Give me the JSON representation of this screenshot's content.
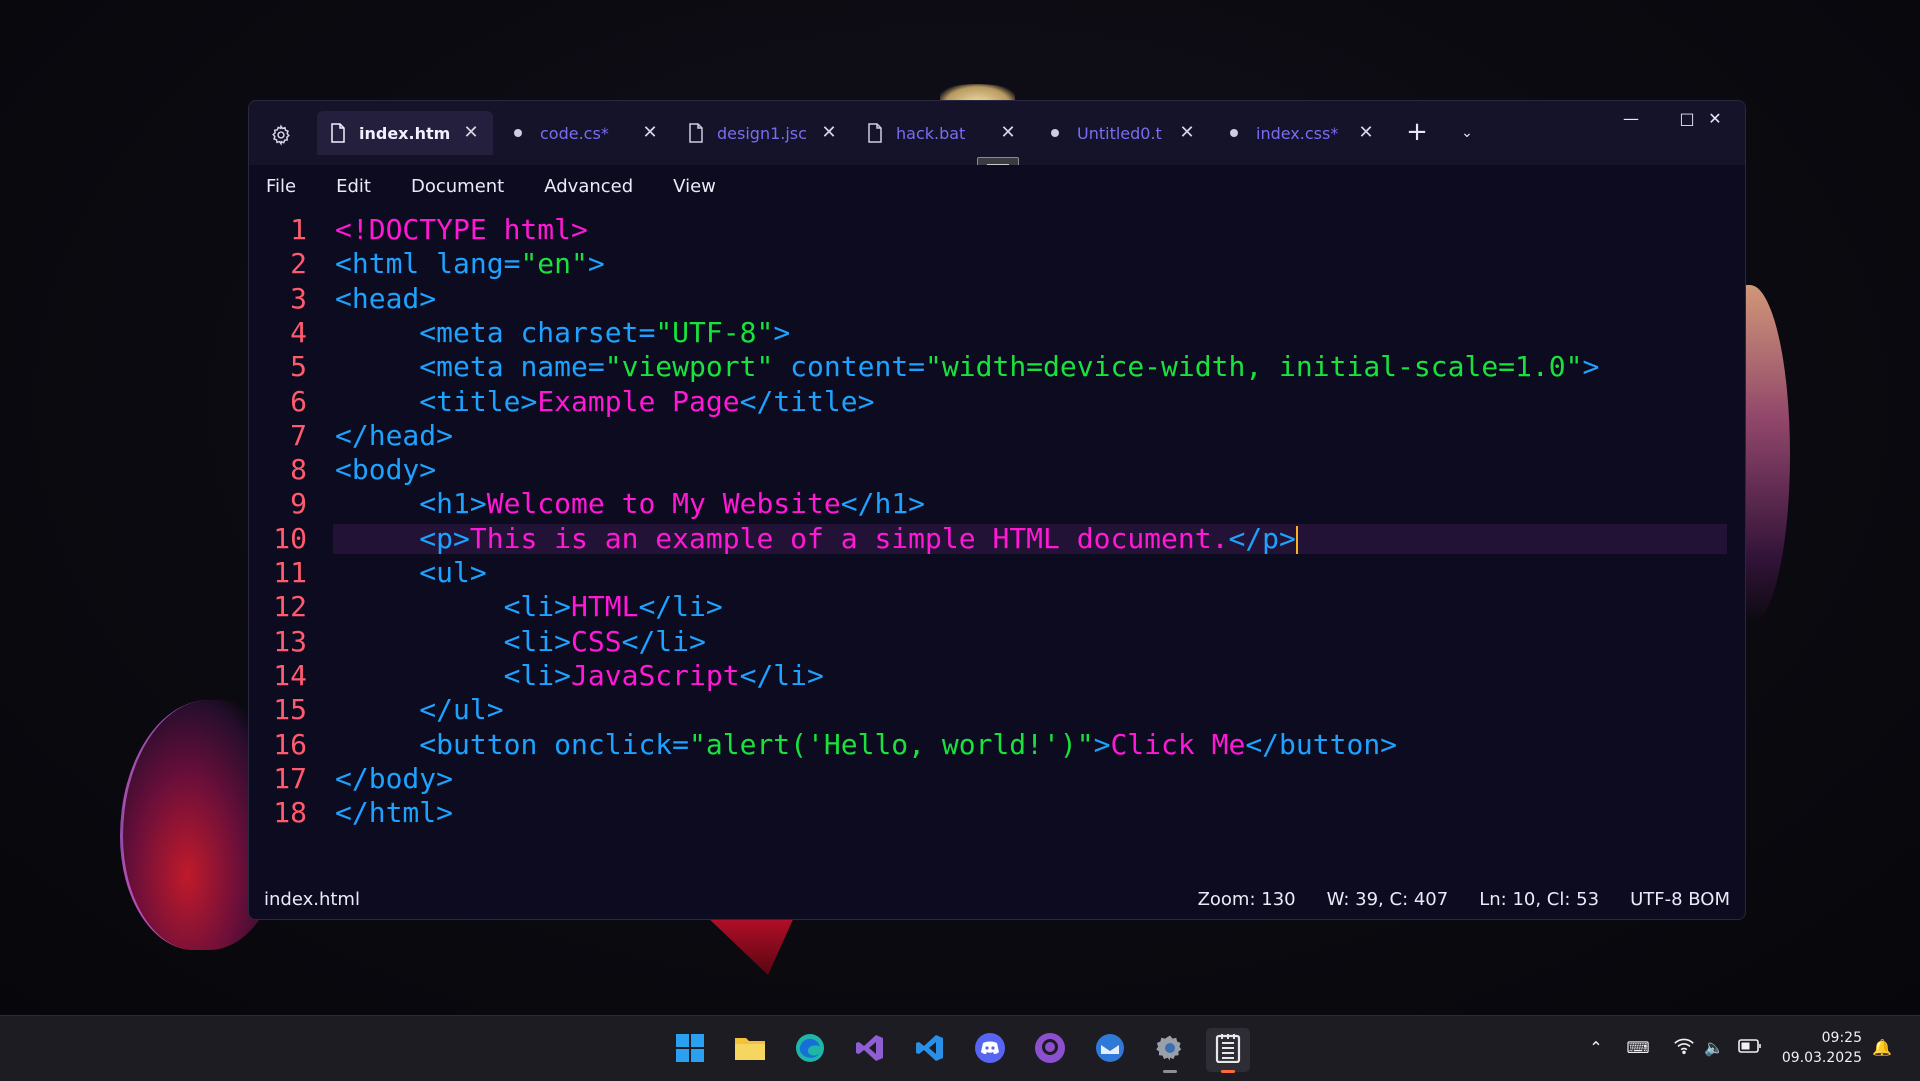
{
  "window": {
    "tabs": [
      {
        "label": "index.htm",
        "active": true,
        "modified": false,
        "icon": "file-icon"
      },
      {
        "label": "code.cs*",
        "active": false,
        "modified": true,
        "icon": "dot-icon"
      },
      {
        "label": "design1.jsc",
        "active": false,
        "modified": false,
        "icon": "file-icon"
      },
      {
        "label": "hack.bat",
        "active": false,
        "modified": false,
        "icon": "file-icon"
      },
      {
        "label": "Untitled0.t",
        "active": false,
        "modified": true,
        "icon": "dot-icon"
      },
      {
        "label": "index.css*",
        "active": false,
        "modified": true,
        "icon": "dot-icon"
      }
    ],
    "menu": [
      "File",
      "Edit",
      "Document",
      "Advanced",
      "View"
    ]
  },
  "editor": {
    "current_line": 10,
    "lines": [
      {
        "n": "1",
        "indent": "",
        "parts": [
          [
            "doc",
            "<!DOCTYPE html>"
          ]
        ]
      },
      {
        "n": "2",
        "indent": "",
        "parts": [
          [
            "tag",
            "<html lang="
          ],
          [
            "str",
            "\"en\""
          ],
          [
            "tag",
            ">"
          ]
        ]
      },
      {
        "n": "3",
        "indent": "",
        "parts": [
          [
            "tag",
            "<head>"
          ]
        ]
      },
      {
        "n": "4",
        "indent": "     ",
        "parts": [
          [
            "tag",
            "<meta charset="
          ],
          [
            "str",
            "\"UTF-8\""
          ],
          [
            "tag",
            ">"
          ]
        ]
      },
      {
        "n": "5",
        "indent": "     ",
        "parts": [
          [
            "tag",
            "<meta name="
          ],
          [
            "str",
            "\"viewport\""
          ],
          [
            "tag",
            " content="
          ],
          [
            "str",
            "\"width=device-width, initial-scale=1.0\""
          ],
          [
            "tag",
            ">"
          ]
        ]
      },
      {
        "n": "6",
        "indent": "     ",
        "parts": [
          [
            "tag",
            "<title>"
          ],
          [
            "text",
            "Example Page"
          ],
          [
            "tag",
            "</title>"
          ]
        ]
      },
      {
        "n": "7",
        "indent": "",
        "parts": [
          [
            "tag",
            "</head>"
          ]
        ]
      },
      {
        "n": "8",
        "indent": "",
        "parts": [
          [
            "tag",
            "<body>"
          ]
        ]
      },
      {
        "n": "9",
        "indent": "     ",
        "parts": [
          [
            "tag",
            "<h1>"
          ],
          [
            "text",
            "Welcome to My Website"
          ],
          [
            "tag",
            "</h1>"
          ]
        ]
      },
      {
        "n": "10",
        "indent": "     ",
        "parts": [
          [
            "tag",
            "<p>"
          ],
          [
            "text",
            "This is an example of a simple HTML document."
          ],
          [
            "tag",
            "</p>"
          ]
        ]
      },
      {
        "n": "11",
        "indent": "     ",
        "parts": [
          [
            "tag",
            "<ul>"
          ]
        ]
      },
      {
        "n": "12",
        "indent": "          ",
        "parts": [
          [
            "tag",
            "<li>"
          ],
          [
            "text",
            "HTML"
          ],
          [
            "tag",
            "</li>"
          ]
        ]
      },
      {
        "n": "13",
        "indent": "          ",
        "parts": [
          [
            "tag",
            "<li>"
          ],
          [
            "text",
            "CSS"
          ],
          [
            "tag",
            "</li>"
          ]
        ]
      },
      {
        "n": "14",
        "indent": "          ",
        "parts": [
          [
            "tag",
            "<li>"
          ],
          [
            "text",
            "JavaScript"
          ],
          [
            "tag",
            "</li>"
          ]
        ]
      },
      {
        "n": "15",
        "indent": "     ",
        "parts": [
          [
            "tag",
            "</ul>"
          ]
        ]
      },
      {
        "n": "16",
        "indent": "     ",
        "parts": [
          [
            "tag",
            "<button onclick="
          ],
          [
            "str",
            "\"alert('Hello, world!')\""
          ],
          [
            "tag",
            ">"
          ],
          [
            "text",
            "Click Me"
          ],
          [
            "tag",
            "</button>"
          ]
        ]
      },
      {
        "n": "17",
        "indent": "",
        "parts": [
          [
            "tag",
            "</body>"
          ]
        ]
      },
      {
        "n": "18",
        "indent": "",
        "parts": [
          [
            "tag",
            "</html>"
          ]
        ]
      }
    ]
  },
  "status": {
    "file": "index.html",
    "zoom": "Zoom: 130",
    "words_chars": "W: 39, C: 407",
    "position": "Ln: 10, Cl: 53",
    "encoding": "UTF-8 BOM"
  },
  "taskbar": {
    "apps": [
      {
        "name": "windows-start-icon",
        "color": "#2aa0f0"
      },
      {
        "name": "file-explorer-icon",
        "color": "#f2c33a"
      },
      {
        "name": "edge-icon",
        "color": "#1fb6a8"
      },
      {
        "name": "visual-studio-icon",
        "color": "#8d5fd3"
      },
      {
        "name": "vscode-icon",
        "color": "#2a8fe6"
      },
      {
        "name": "discord-icon",
        "color": "#5865f2"
      },
      {
        "name": "github-desktop-icon",
        "color": "#8c4fd0"
      },
      {
        "name": "thunderbird-icon",
        "color": "#2f7ad8"
      },
      {
        "name": "settings-app-icon",
        "color": "#9aa0aa"
      },
      {
        "name": "notepads-icon",
        "color": "#e8e8ec"
      }
    ],
    "time": "09:25",
    "date": "09.03.2025"
  },
  "colors": {
    "tag": "#1ea2ff",
    "string": "#19e23c",
    "text": "#ff18d6",
    "line_number": "#ff5a6e",
    "caret": "#ffb020",
    "current_line_bg": "#221336"
  }
}
